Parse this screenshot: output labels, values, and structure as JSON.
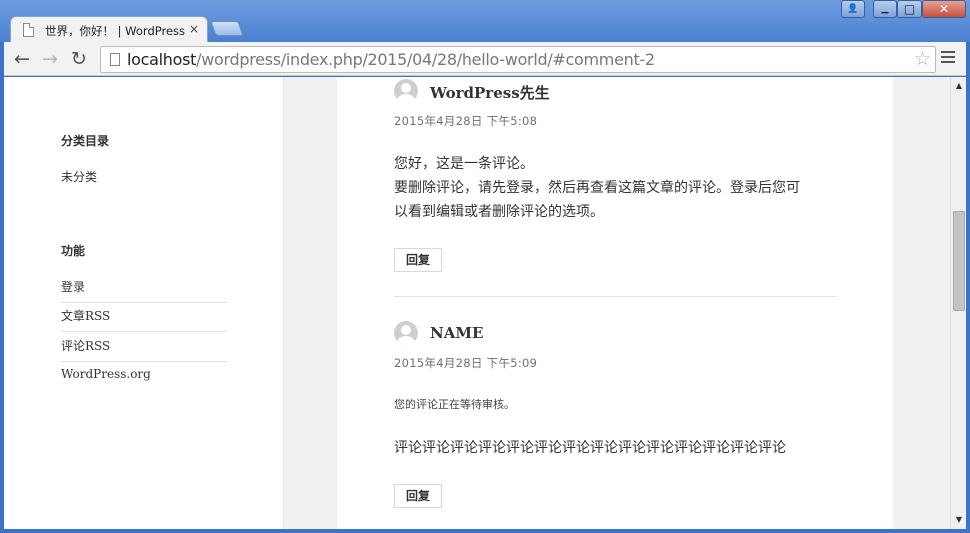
{
  "browser": {
    "tab_title": "世界，你好！ | WordPress",
    "tab_close": "×",
    "url_host": "localhost",
    "url_path": "/wordpress/index.php/2015/04/28/hello-world/#comment-2",
    "back_glyph": "←",
    "forward_glyph": "→",
    "reload_glyph": "↻",
    "star_glyph": "☆",
    "window_buttons": {
      "user": "👤",
      "minimize": "▁",
      "maximize": "□",
      "close": "✕"
    }
  },
  "sidebar": {
    "categories_title": "分类目录",
    "categories": [
      "未分类"
    ],
    "meta_title": "功能",
    "meta_links": [
      "登录",
      "文章RSS",
      "评论RSS",
      "WordPress.org"
    ]
  },
  "comments": [
    {
      "author": "WordPress先生",
      "date": "2015年4月28日 下午5:08",
      "lines": [
        "您好，这是一条评论。",
        "要删除评论，请先登录，然后再查看这篇文章的评论。登录后您可",
        "以看到编辑或者删除评论的选项。"
      ],
      "reply": "回复"
    },
    {
      "author": "NAME",
      "date": "2015年4月28日 下午5:09",
      "moderation": "您的评论正在等待审核。",
      "lines": [
        "评论评论评论评论评论评论评论评论评论评论评论评论评论评论"
      ],
      "reply": "回复"
    }
  ],
  "colors": {
    "frame": "#4a80d0",
    "page_bg": "#f1f1f1",
    "text": "#333333"
  }
}
